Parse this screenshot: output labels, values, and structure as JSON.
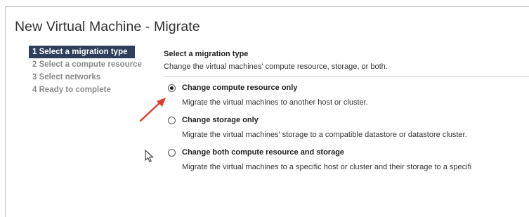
{
  "dialog": {
    "title": "New Virtual Machine - Migrate"
  },
  "steps": [
    {
      "label": "1 Select a migration type",
      "active": true
    },
    {
      "label": "2 Select a compute resource",
      "active": false
    },
    {
      "label": "3 Select networks",
      "active": false
    },
    {
      "label": "4 Ready to complete",
      "active": false
    }
  ],
  "content": {
    "heading": "Select a migration type",
    "subheading": "Change the virtual machines' compute resource, storage, or both.",
    "options": [
      {
        "label": "Change compute resource only",
        "description": "Migrate the virtual machines to another host or cluster.",
        "selected": true
      },
      {
        "label": "Change storage only",
        "description": "Migrate the virtual machines' storage to a compatible datastore or datastore cluster.",
        "selected": false
      },
      {
        "label": "Change both compute resource and storage",
        "description": "Migrate the virtual machines to a specific host or cluster and their storage to a specifi",
        "selected": false
      }
    ]
  },
  "colors": {
    "active_step_bg": "#2d3f5c",
    "annotation_arrow": "#e03b2f"
  },
  "icons": {
    "annotation": "red-arrow-icon",
    "pointer": "mouse-cursor-icon"
  }
}
